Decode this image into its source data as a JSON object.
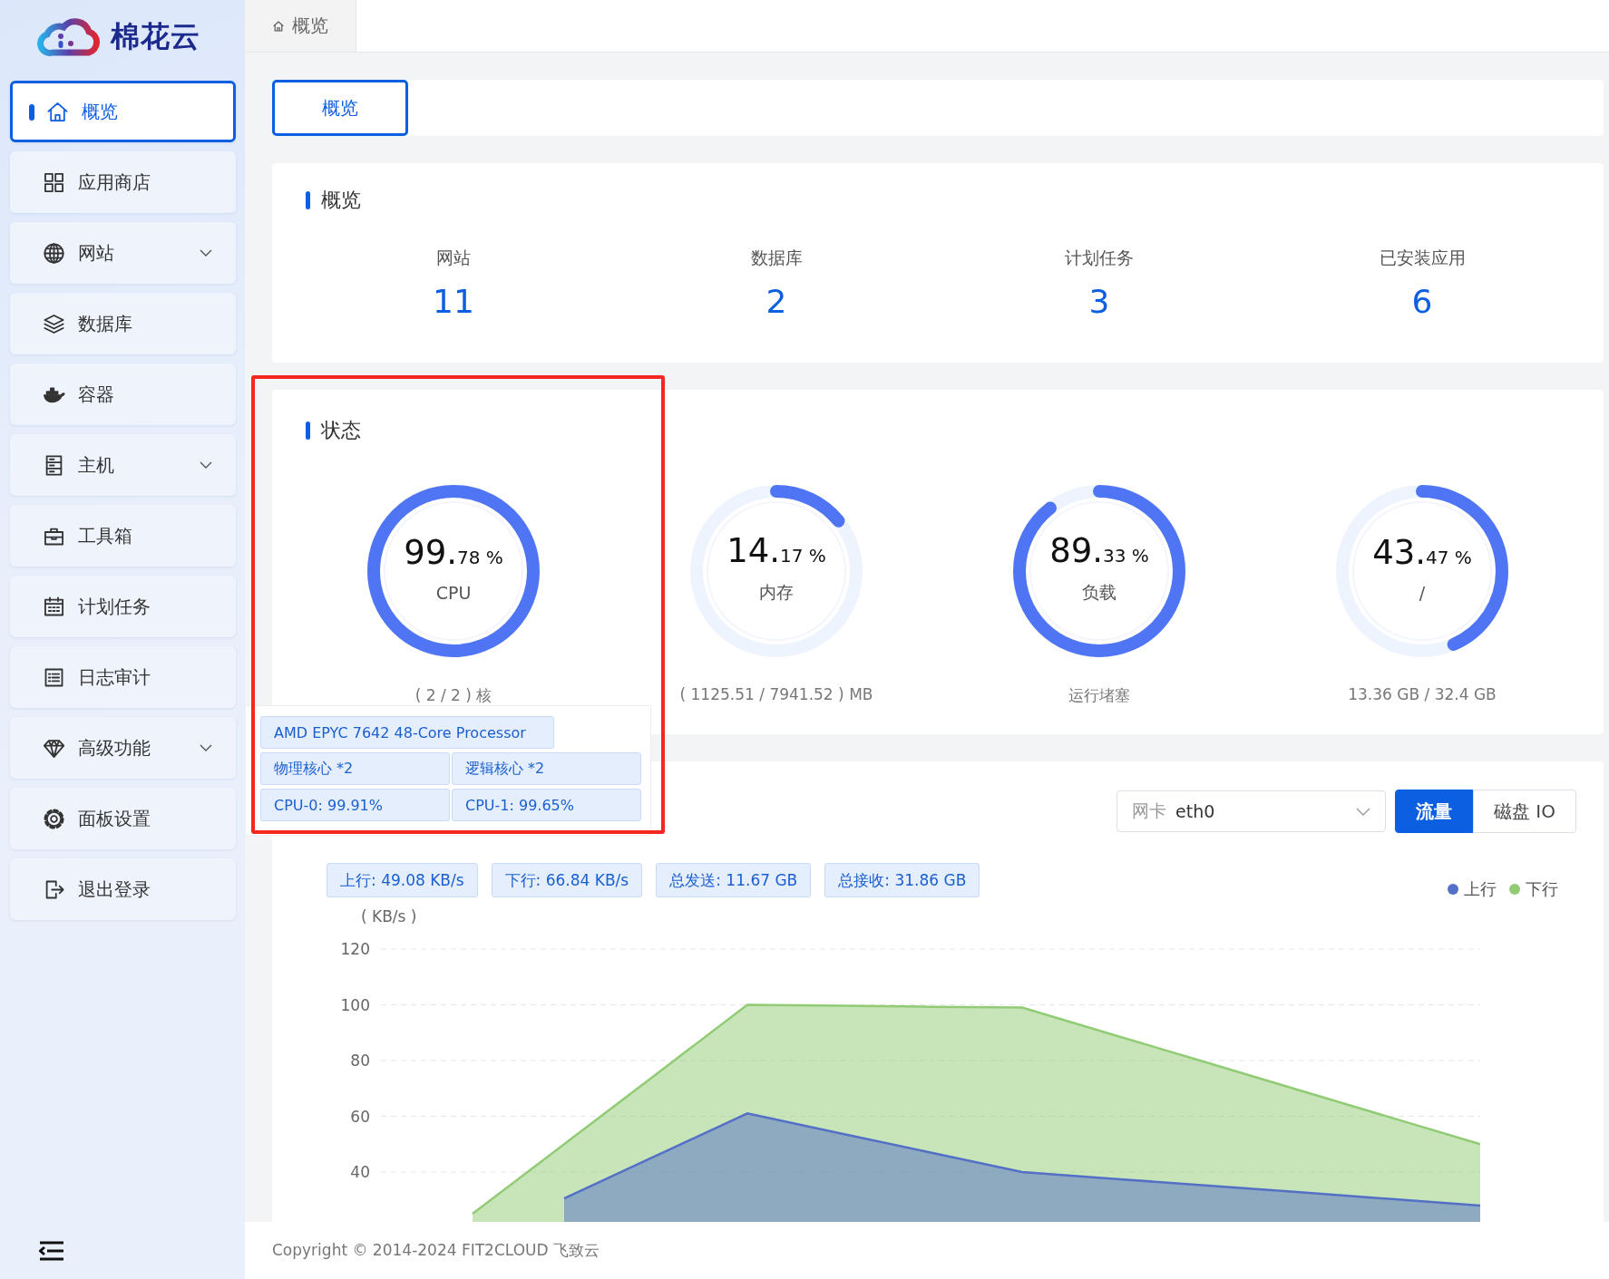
{
  "brand": {
    "name": "棉花云"
  },
  "sidebar": {
    "items": [
      {
        "label": "概览",
        "selected": true,
        "submenu": false
      },
      {
        "label": "应用商店",
        "selected": false,
        "submenu": false
      },
      {
        "label": "网站",
        "selected": false,
        "submenu": true,
        "expanded": false
      },
      {
        "label": "数据库",
        "selected": false,
        "submenu": false
      },
      {
        "label": "容器",
        "selected": false,
        "submenu": false
      },
      {
        "label": "主机",
        "selected": false,
        "submenu": true,
        "expanded": false
      },
      {
        "label": "工具箱",
        "selected": false,
        "submenu": false
      },
      {
        "label": "计划任务",
        "selected": false,
        "submenu": false
      },
      {
        "label": "日志审计",
        "selected": false,
        "submenu": false
      },
      {
        "label": "高级功能",
        "selected": false,
        "submenu": true,
        "expanded": false
      },
      {
        "label": "面板设置",
        "selected": false,
        "submenu": false
      },
      {
        "label": "退出登录",
        "selected": false,
        "submenu": false
      }
    ]
  },
  "tabs": [
    {
      "label": "概览",
      "selected": true
    }
  ],
  "subnav": [
    {
      "label": "概览",
      "selected": true
    }
  ],
  "overview": {
    "title": "概览",
    "stats": [
      {
        "label": "网站",
        "value": "11"
      },
      {
        "label": "数据库",
        "value": "2"
      },
      {
        "label": "计划任务",
        "value": "3"
      },
      {
        "label": "已安装应用",
        "value": "6"
      }
    ]
  },
  "status": {
    "title": "状态",
    "gauges": [
      {
        "whole": "99.",
        "fraction": "78 %",
        "label": "CPU",
        "level": 0.9978,
        "detail": "( 2 / 2 ) 核"
      },
      {
        "whole": "14.",
        "fraction": "17 %",
        "label": "内存",
        "level": 0.1417,
        "detail": "( 1125.51 / 7941.52 ) MB"
      },
      {
        "whole": "89.",
        "fraction": "33 %",
        "label": "负载",
        "level": 0.8933,
        "detail": "运行堵塞"
      },
      {
        "whole": "43.",
        "fraction": "47 %",
        "label": "/",
        "level": 0.4347,
        "detail": "13.36 GB / 32.4 GB"
      }
    ],
    "popover": {
      "tags": [
        "AMD EPYC 7642 48-Core Processor",
        "物理核心 *2",
        "逻辑核心 *2",
        "CPU-0: 99.91%",
        "CPU-1: 99.65%"
      ]
    }
  },
  "network": {
    "select": {
      "placeholder": "网卡",
      "value": "eth0"
    },
    "modes": [
      {
        "label": "流量",
        "selected": true
      },
      {
        "label": "磁盘 IO",
        "selected": false
      }
    ],
    "tags": [
      "上行: 49.08 KB/s",
      "下行: 66.84 KB/s",
      "总发送: 11.67 GB",
      "总接收: 31.86 GB"
    ],
    "chart_data": {
      "type": "area",
      "grid": true,
      "ylabel": "( KB/s )",
      "ylim": [
        0,
        120
      ],
      "yticks": [
        40,
        60,
        80,
        100,
        120
      ],
      "series": [
        {
          "name": "上行",
          "color": "#5470c6",
          "values": [
            null,
            null,
            30.5,
            45.8,
            61,
            54,
            47,
            40,
            37.6,
            35.2,
            32.8,
            30.4,
            28
          ]
        },
        {
          "name": "下行",
          "color": "#91cc75",
          "values": [
            null,
            25,
            50,
            75,
            100,
            99.7,
            99.3,
            99,
            89.2,
            79.4,
            69.6,
            59.8,
            50
          ]
        }
      ]
    }
  },
  "footer": "Copyright © 2014-2024 FIT2CLOUD 飞致云"
}
